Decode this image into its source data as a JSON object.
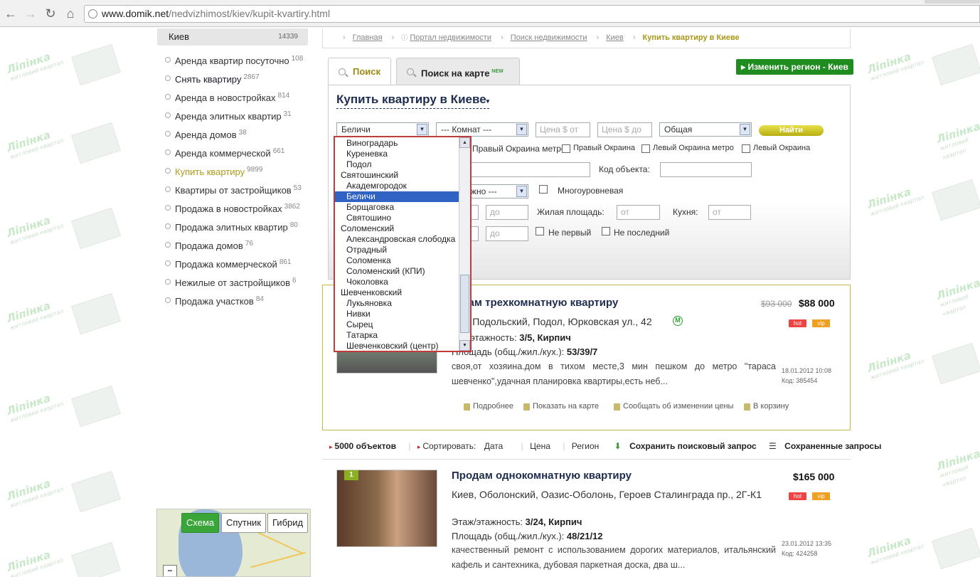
{
  "browser": {
    "url_host": "www.domik.net",
    "url_path": "/nedvizhimost/kiev/kupit-kvartiry.html"
  },
  "sidebar": {
    "region": "Киев",
    "region_count": "14339",
    "items": [
      {
        "label": "Аренда квартир посуточно",
        "count": "108"
      },
      {
        "label": "Снять квартиру",
        "count": "2867"
      },
      {
        "label": "Аренда в новостройках",
        "count": "814"
      },
      {
        "label": "Аренда элитных квартир",
        "count": "31"
      },
      {
        "label": "Аренда домов",
        "count": "38"
      },
      {
        "label": "Аренда коммерческой",
        "count": "661"
      },
      {
        "label": "Купить квартиру",
        "count": "9899"
      },
      {
        "label": "Квартиры от застройщиков",
        "count": "53"
      },
      {
        "label": "Продажа в новостройках",
        "count": "3862"
      },
      {
        "label": "Продажа элитных квартир",
        "count": "80"
      },
      {
        "label": "Продажа домов",
        "count": "76"
      },
      {
        "label": "Продажа коммерческой",
        "count": "861"
      },
      {
        "label": "Нежилые от застройщиков",
        "count": "6"
      },
      {
        "label": "Продажа участков",
        "count": "84"
      }
    ]
  },
  "map": {
    "schema": "Схема",
    "satellite": "Спутник",
    "hybrid": "Гибрид",
    "zoom_out": "−"
  },
  "breadcrumb": [
    "Главная",
    "Портал недвижимости",
    "Поиск недвижимости",
    "Киев",
    "Купить квартиру в Киеве"
  ],
  "tabs": {
    "search": "Поиск",
    "map_search": "Поиск на карте",
    "new_badge": "NEW"
  },
  "region_button": "Изменить регион - Киев",
  "search": {
    "title": "Купить квартиру в Киеве",
    "district_value": "Беличи",
    "rooms_value": "--- Комнат ---",
    "price_from_placeholder": "Цена $ от",
    "price_to_placeholder": "Цена $ до",
    "area_value": "Общая",
    "find_button": "Найти",
    "metro_options": [
      "Правый Окраина метро",
      "Правый Окраина",
      "Левый Окраина метро",
      "Левый Окраина"
    ],
    "object_code_label": "Код объекта:",
    "floor_select_fragment": "жно ---",
    "multilevel_label": "Многоуровневая",
    "living_area_label": "Жилая площадь:",
    "kitchen_label": "Кухня:",
    "from_placeholder": "от",
    "to_placeholder": "до",
    "not_first_label": "Не первый",
    "not_last_label": "Не последний"
  },
  "dropdown": {
    "items": [
      {
        "label": "Виноградарь",
        "group": false
      },
      {
        "label": "Куреневка",
        "group": false
      },
      {
        "label": "Подол",
        "group": false
      },
      {
        "label": "Святошинский",
        "group": true
      },
      {
        "label": "Академгородок",
        "group": false
      },
      {
        "label": "Беличи",
        "group": false,
        "selected": true
      },
      {
        "label": "Борщаговка",
        "group": false
      },
      {
        "label": "Святошино",
        "group": false
      },
      {
        "label": "Соломенский",
        "group": true
      },
      {
        "label": "Александровская слободка",
        "group": false
      },
      {
        "label": "Отрадный",
        "group": false
      },
      {
        "label": "Соломенка",
        "group": false
      },
      {
        "label": "Соломенский (КПИ)",
        "group": false
      },
      {
        "label": "Чоколовка",
        "group": false
      },
      {
        "label": "Шевченковский",
        "group": true
      },
      {
        "label": "Лукьяновка",
        "group": false
      },
      {
        "label": "Нивки",
        "group": false
      },
      {
        "label": "Сырец",
        "group": false
      },
      {
        "label": "Татарка",
        "group": false
      },
      {
        "label": "Шевченковский (центр)",
        "group": false
      }
    ]
  },
  "listing1": {
    "title": "дам трехкомнатную квартиру",
    "address": "в, Подольский, Подол, Юрковская ул., 42",
    "metro_icon": "М",
    "floor_label": "ж/этажность:",
    "floor_value": "3/5, Кирпич",
    "area_label": "Площадь (общ./жил./кух.):",
    "area_value": "53/39/7",
    "description": "своя,от хозяина.дом в тихом месте,3 мин пешком до метро \"тараса шевченко\",удачная планировка квартиры,есть неб...",
    "old_price": "$93 000",
    "price": "$88 000",
    "badge_hot": "hot",
    "badge_vip": "vip",
    "date": "18.01.2012 10:08",
    "code": "Код: 385454",
    "actions": [
      "Подробнее",
      "Показать на карте",
      "Сообщать об изменении цены",
      "В корзину"
    ]
  },
  "results_bar": {
    "count": "5000 объектов",
    "sort_label": "Сортировать:",
    "sort_date": "Дата",
    "sort_price": "Цена",
    "sort_region": "Регион",
    "save_query": "Сохранить поисковый запрос",
    "saved_queries": "Сохраненные запросы"
  },
  "listing2": {
    "number": "1",
    "title": "Продам однокомнатную квартиру",
    "address": "Киев, Оболонский, Оазис-Оболонь, Героев Сталинграда пр., 2Г-К1",
    "floor_label": "Этаж/этажность:",
    "floor_value": "3/24, Кирпич",
    "area_label": "Площадь (общ./жил./кух.):",
    "area_value": "48/21/12",
    "description": "качественный ремонт с использованием дорогих материалов, итальянский кафель и сантехника, дубовая паркетная доска, два ш...",
    "price": "$165 000",
    "badge_hot": "hot",
    "badge_vip": "vip",
    "date": "23.01.2012 13:35",
    "code": "Код: 424258"
  },
  "watermark": {
    "brand": "Лiпiнка",
    "tagline": "житловий квартал"
  }
}
